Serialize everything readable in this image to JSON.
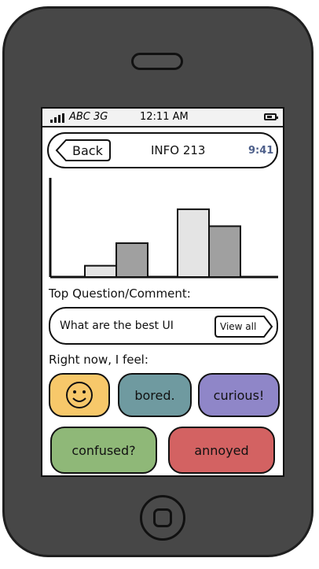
{
  "status_bar": {
    "carrier": "ABC 3G",
    "time": "12:11 AM"
  },
  "nav": {
    "back_label": "Back",
    "title": "INFO 213",
    "clock": "9:41"
  },
  "chart_data": {
    "type": "bar",
    "categories": [
      "",
      "",
      "",
      ""
    ],
    "series": [
      {
        "values": [
          2,
          6,
          12,
          9
        ]
      }
    ],
    "colors": [
      "#e4e4e4",
      "#a0a0a0",
      "#e4e4e4",
      "#a0a0a0"
    ],
    "ylim": [
      0,
      17
    ],
    "xlabel": "",
    "ylabel": "",
    "title": ""
  },
  "question": {
    "label": "Top Question/Comment:",
    "text": "What are the best UI",
    "view_all_label": "View all"
  },
  "feel": {
    "label": "Right now, I feel:",
    "moods": {
      "happy_icon": "smiley-face-icon",
      "bored": "bored.",
      "curious": "curious!",
      "confused": "confused?",
      "annoyed": "annoyed"
    }
  },
  "colors": {
    "phone_body": "#474747",
    "happy": "#f7c86a",
    "bored": "#6f9aa0",
    "curious": "#8f86c8",
    "confused": "#8fb878",
    "annoyed": "#d36262",
    "clock_text": "#4d5f8a"
  }
}
